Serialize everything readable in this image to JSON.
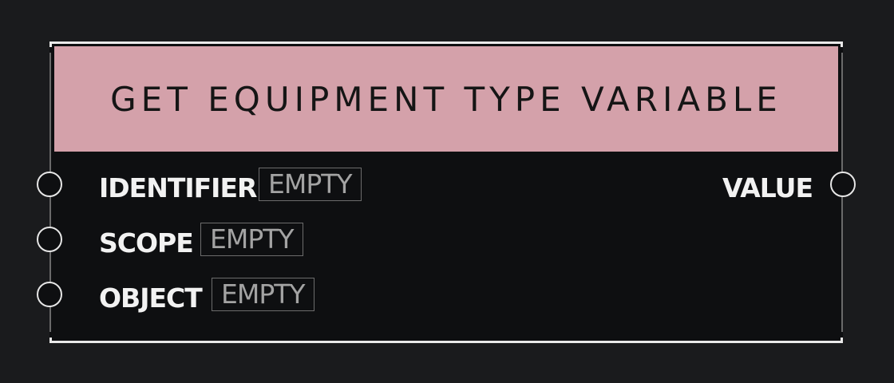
{
  "node": {
    "title": "GET EQUIPMENT TYPE VARIABLE",
    "header_color": "#d4a1aa",
    "inputs": [
      {
        "label": "IDENTIFIER",
        "value": "EMPTY"
      },
      {
        "label": "SCOPE",
        "value": "EMPTY"
      },
      {
        "label": "OBJECT",
        "value": "EMPTY"
      }
    ],
    "outputs": [
      {
        "label": "VALUE"
      }
    ]
  }
}
